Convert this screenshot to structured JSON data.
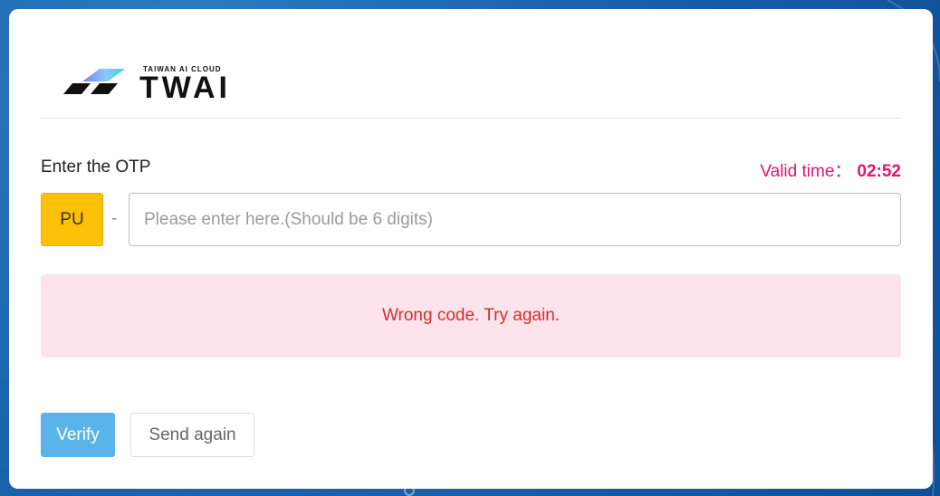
{
  "colors": {
    "background": "#1a63ad",
    "card": "#ffffff",
    "timer": "#e0166d",
    "prefix": "#ffc107",
    "alert_bg": "#fde3ec",
    "alert_text": "#d62d2d",
    "verify": "#5ab4e9"
  },
  "brand": {
    "small_text": "TAIWAN AI CLOUD",
    "logo_text": "TWAI",
    "logo_icon": "twai-logo-icon"
  },
  "otp": {
    "label": "Enter the OTP",
    "valid_label": "Valid time：",
    "valid_time": "02:52",
    "prefix": "PU",
    "separator": "-",
    "input_value": "",
    "placeholder": "Please enter here.(Should be 6 digits)"
  },
  "alert": {
    "message": "Wrong code. Try again."
  },
  "actions": {
    "verify_label": "Verify",
    "send_again_label": "Send again"
  }
}
